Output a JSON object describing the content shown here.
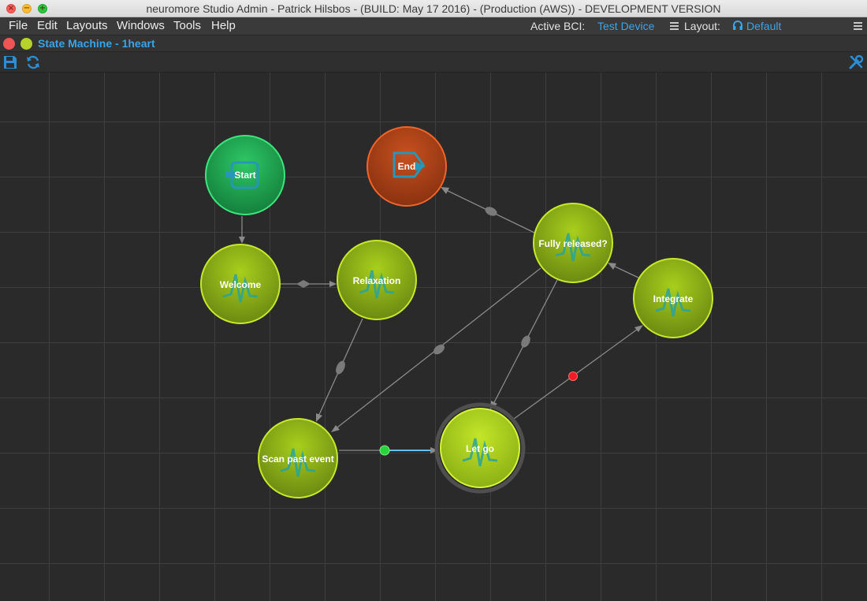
{
  "window": {
    "title": "neuromore Studio Admin - Patrick Hilsbos - (BUILD: May 17 2016) - (Production (AWS)) - DEVELOPMENT VERSION"
  },
  "menu": {
    "file": "File",
    "edit": "Edit",
    "layouts": "Layouts",
    "windows": "Windows",
    "tools": "Tools",
    "help": "Help"
  },
  "status": {
    "active_bci_label": "Active BCI:",
    "active_bci_value": "Test Device",
    "layout_label": "Layout:",
    "layout_value": "Default"
  },
  "dock": {
    "title": "State Machine - 1heart"
  },
  "colors": {
    "accent": "#3aa4e8",
    "start": "#2ec866",
    "end": "#f0642a",
    "state": "#a6cf1c",
    "active_transition": "#29d33b",
    "error_marker": "#ee1c24"
  },
  "icons": {
    "save": "save-icon",
    "refresh": "refresh-icon",
    "wrench": "wrench-icon",
    "hamburger": "hamburger-icon",
    "headset": "headset-icon",
    "close": "close-icon",
    "minimize": "minimize-icon",
    "maximize": "maximize-icon"
  },
  "state_machine": {
    "nodes": [
      {
        "id": "start",
        "label": "Start",
        "type": "entry"
      },
      {
        "id": "end",
        "label": "End",
        "type": "exit"
      },
      {
        "id": "welcome",
        "label": "Welcome",
        "type": "state"
      },
      {
        "id": "relaxation",
        "label": "Relaxation",
        "type": "state"
      },
      {
        "id": "fully_released",
        "label": "Fully released?",
        "type": "state"
      },
      {
        "id": "integrate",
        "label": "Integrate",
        "type": "state"
      },
      {
        "id": "scan_past_event",
        "label": "Scan past event",
        "type": "state"
      },
      {
        "id": "let_go",
        "label": "Let go",
        "type": "state",
        "active": true
      }
    ],
    "transitions": [
      {
        "from": "start",
        "to": "welcome"
      },
      {
        "from": "welcome",
        "to": "relaxation"
      },
      {
        "from": "relaxation",
        "to": "scan_past_event"
      },
      {
        "from": "fully_released",
        "to": "scan_past_event"
      },
      {
        "from": "fully_released",
        "to": "let_go"
      },
      {
        "from": "fully_released",
        "to": "end"
      },
      {
        "from": "integrate",
        "to": "fully_released"
      },
      {
        "from": "scan_past_event",
        "to": "let_go",
        "active": true
      },
      {
        "from": "let_go",
        "to": "integrate",
        "error": true
      }
    ]
  }
}
